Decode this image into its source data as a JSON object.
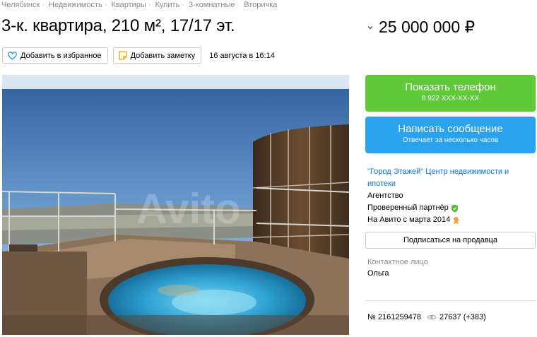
{
  "breadcrumbs": [
    "Челябинск",
    "Недвижимость",
    "Квартиры",
    "Купить",
    "3-комнатные",
    "Вторичка"
  ],
  "listing": {
    "title": "3-к. квартира, 210 м², 17/17 эт.",
    "price": "25 000 000 ₽",
    "date": "16 августа в 16:14"
  },
  "actions": {
    "favorite_label": "Добавить в избранное",
    "note_label": "Добавить заметку"
  },
  "photo": {
    "watermark": "Avito"
  },
  "contact_buttons": {
    "phone_label": "Показать телефон",
    "phone_number": "8 922 XXX-XX-XX",
    "message_label": "Написать сообщение",
    "message_sub": "Отвечает за несколько часов"
  },
  "seller": {
    "name": "\"Город Этажей\" Центр недвижимости и ипотеки",
    "type": "Агентство",
    "verified": "Проверенный партнёр",
    "since": "На Авито с марта 2014",
    "subscribe_label": "Подписаться на продавца",
    "contact_label": "Контактное лицо",
    "contact_name": "Ольга"
  },
  "meta": {
    "id": "№ 2161259478",
    "views": "27637 (+383)"
  },
  "colors": {
    "green": "#5fc93a",
    "blue": "#2aa3ee",
    "link": "#0a73d6"
  }
}
